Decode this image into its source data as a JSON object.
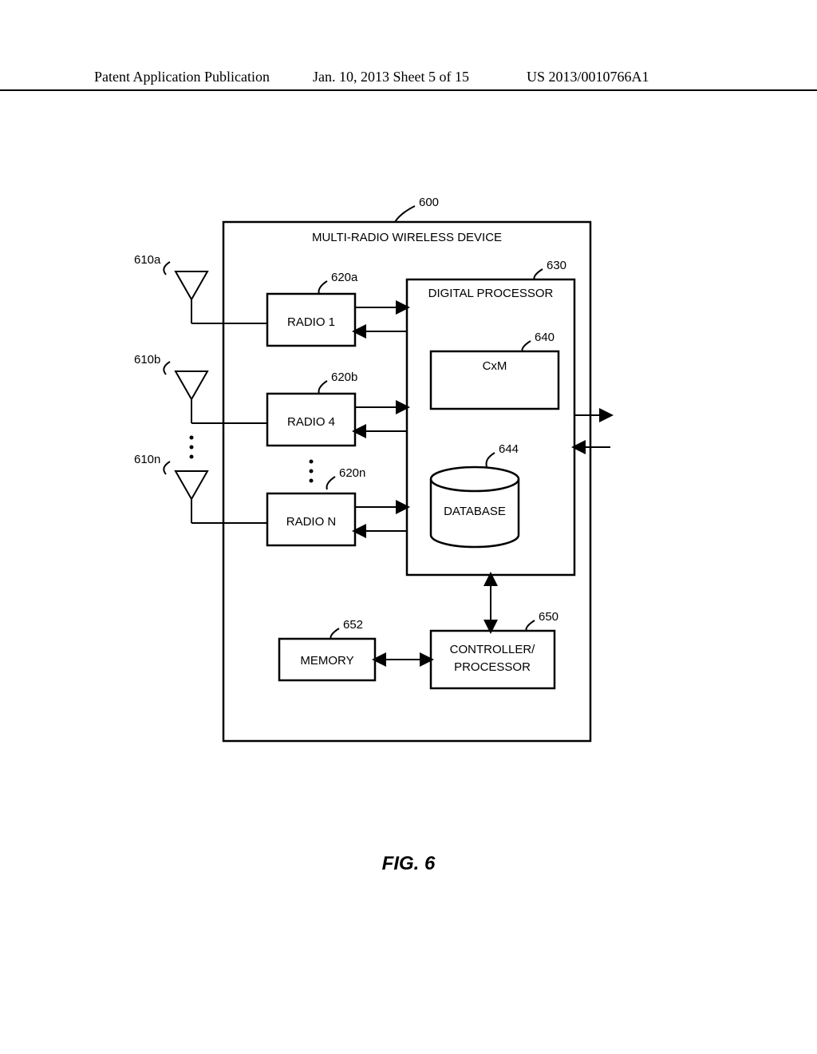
{
  "header": {
    "left": "Patent Application Publication",
    "center": "Jan. 10, 2013  Sheet 5 of 15",
    "right": "US 2013/0010766A1"
  },
  "diagram": {
    "title": "MULTI-RADIO WIRELESS DEVICE",
    "ref_main": "600",
    "antennas": {
      "a_ref": "610a",
      "b_ref": "610b",
      "n_ref": "610n"
    },
    "radios": {
      "a_ref": "620a",
      "a_label": "RADIO 1",
      "b_ref": "620b",
      "b_label": "RADIO 4",
      "n_ref": "620n",
      "n_label": "RADIO N"
    },
    "processor_ref": "630",
    "processor_label": "DIGITAL PROCESSOR",
    "cxm_ref": "640",
    "cxm_label": "CxM",
    "db_ref": "644",
    "db_label": "DATABASE",
    "controller_ref": "650",
    "controller_line1": "CONTROLLER/",
    "controller_line2": "PROCESSOR",
    "memory_ref": "652",
    "memory_label": "MEMORY"
  },
  "caption": "FIG. 6"
}
